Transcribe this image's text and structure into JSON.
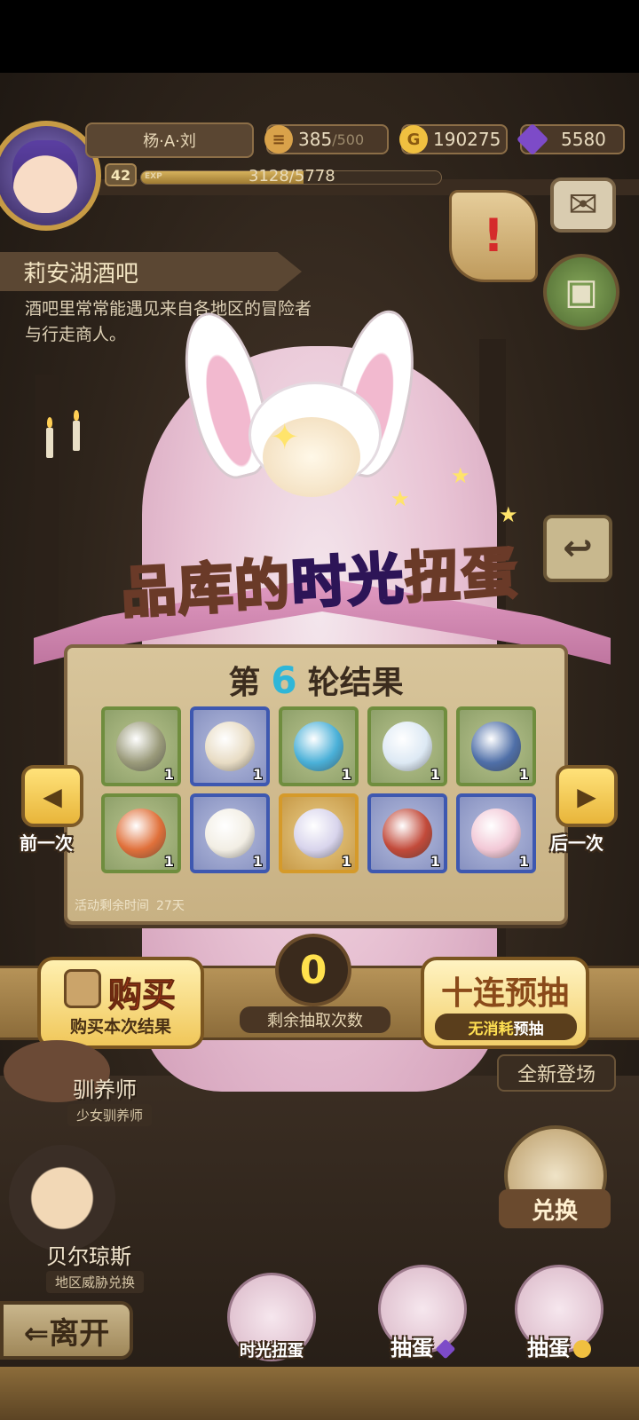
{
  "player": {
    "name": "杨·A·刘",
    "level": "42",
    "exp_label": "EXP",
    "exp_text": "3128/5778",
    "exp_fraction": 0.541
  },
  "resources": {
    "stamina": "385",
    "stamina_max": "/500",
    "gold": "190275",
    "gems": "5580"
  },
  "location": {
    "title": "莉安湖酒吧",
    "description": "酒吧里常常能遇见来自各地区的冒险者与行走商人。"
  },
  "event": {
    "title_part1": "品库的",
    "title_highlight": "时光",
    "title_part2": "扭蛋",
    "round_prefix": "第",
    "round_number": "6",
    "round_suffix": "轮结果",
    "time_left_label": "活动剩余时间",
    "time_left_value": "27天",
    "prev_label": "前一次",
    "next_label": "后一次"
  },
  "results": [
    {
      "name": "leaf-item",
      "rarity": "green",
      "count": "1",
      "color": "#9a9a7a"
    },
    {
      "name": "walrus-plush",
      "rarity": "blue",
      "count": "1",
      "color": "#e8dcc4"
    },
    {
      "name": "spiral-shell",
      "rarity": "green",
      "count": "1",
      "color": "#4ab0d8"
    },
    {
      "name": "potion-flask",
      "rarity": "green",
      "count": "1",
      "color": "#dde9f4"
    },
    {
      "name": "blue-sprout",
      "rarity": "green",
      "count": "1",
      "color": "#4f6fa8"
    },
    {
      "name": "fire-stone",
      "rarity": "green",
      "count": "1",
      "color": "#e0703a"
    },
    {
      "name": "horned-fluff",
      "rarity": "blue",
      "count": "1",
      "color": "#f2eee4"
    },
    {
      "name": "winged-cocoon",
      "rarity": "gold",
      "count": "1",
      "color": "#d8d4ec"
    },
    {
      "name": "cat-hood",
      "rarity": "blue",
      "count": "1",
      "color": "#c24a3a"
    },
    {
      "name": "lotus-bud",
      "rarity": "blue",
      "count": "1",
      "color": "#f2c8d6"
    }
  ],
  "actions": {
    "buy_title": "购买",
    "buy_sub": "购买本次结果",
    "remaining_count": "0",
    "remaining_label": "剩余抽取次数",
    "ten_title": "十连预抽",
    "ten_sub_highlight": "无消耗",
    "ten_sub_rest": "预抽"
  },
  "scene": {
    "new_label": "全新登场",
    "npc1_name": "驯养师",
    "npc1_sub": "少女驯养师",
    "npc2_name": "贝尔琼斯",
    "npc2_sub": "地区威胁兑换",
    "exchange_label": "兑换"
  },
  "bottom": {
    "leave": "⇐离开",
    "tab1": "时光扭蛋",
    "tab2": "抽蛋",
    "tab3": "抽蛋"
  },
  "colors": {
    "accent_gold": "#f0c75a",
    "round_number": "#2fb6d8",
    "counter": "#ffe14d"
  }
}
